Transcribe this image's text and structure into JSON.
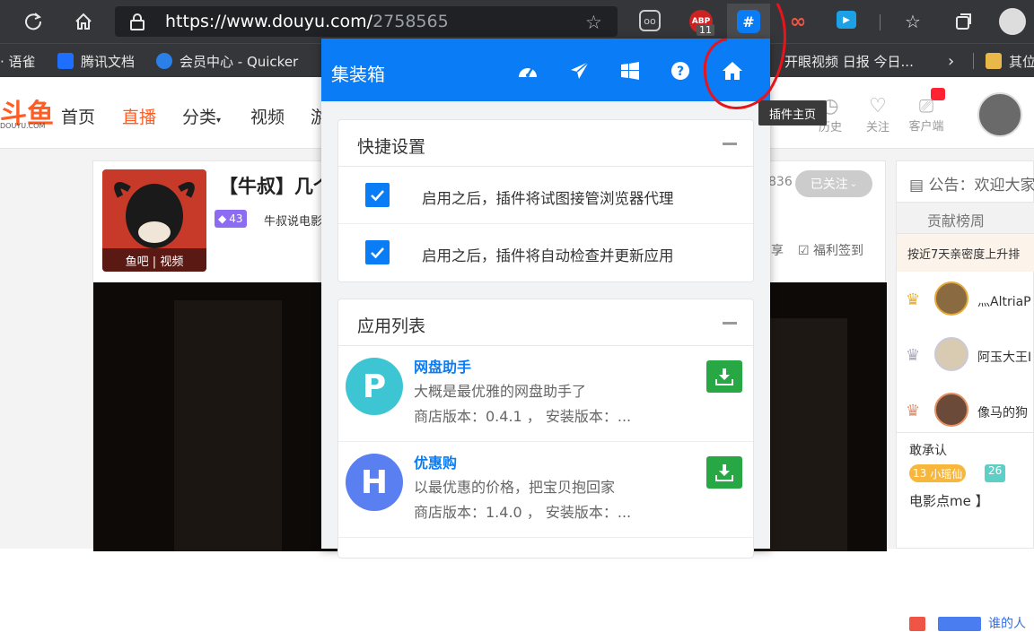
{
  "browser": {
    "url_host": "https://www.douyu.com/",
    "url_path": "2758565",
    "ext_badge": "11",
    "ext_abp": "ABP",
    "bookmarks": [
      "· 语雀",
      "腾讯文档",
      "会员中心 - Quicker",
      "开眼视频 日报 今日...",
      "其位"
    ]
  },
  "site": {
    "logo": "斗鱼",
    "logo_sub": "DOUYU.COM",
    "nav": [
      "首页",
      "直播",
      "分类",
      "视频",
      "游"
    ],
    "user_icons": [
      "历史",
      "关注",
      "客户端"
    ],
    "room_title": "【牛叔】几个",
    "level_badge": "43",
    "streamer": "牛叔说电影",
    "fans_count": "836",
    "follow_btn": "已关注",
    "thumb_caption": "鱼吧 | 视频",
    "share_label": "享",
    "checkin_label": "福利签到",
    "notice": "公告：欢迎大家",
    "tab_rank": "贡献榜周",
    "rank_note": "按近7天亲密度上升排",
    "ranks": [
      {
        "num": "1",
        "name": "灬AltriaP"
      },
      {
        "num": "2",
        "name": "阿玉大王I"
      },
      {
        "num": "3",
        "name": "像马的狗"
      }
    ],
    "chat": [
      {
        "text": "敢承认"
      },
      {
        "level": "13",
        "badge": "小瑶仙",
        "lvl2": "26"
      },
      {
        "text": "电影点me 】"
      },
      {
        "text": "谁的人"
      }
    ]
  },
  "popup": {
    "title": "集装箱",
    "tooltip": "插件主页",
    "settings_title": "快捷设置",
    "settings": [
      {
        "label": "启用之后，插件将试图接管浏览器代理",
        "checked": true
      },
      {
        "label": "启用之后，插件将自动检查并更新应用",
        "checked": true
      }
    ],
    "apps_title": "应用列表",
    "apps": [
      {
        "letter": "P",
        "name": "网盘助手",
        "desc": "大概是最优雅的网盘助手了",
        "version": "商店版本：0.4.1 ， 安装版本：...",
        "color": "#3ec5d3"
      },
      {
        "letter": "H",
        "name": "优惠购",
        "desc": "以最优惠的价格，把宝贝抱回家",
        "version": "商店版本：1.4.0 ， 安装版本：...",
        "color": "#5a7ff0"
      }
    ]
  }
}
